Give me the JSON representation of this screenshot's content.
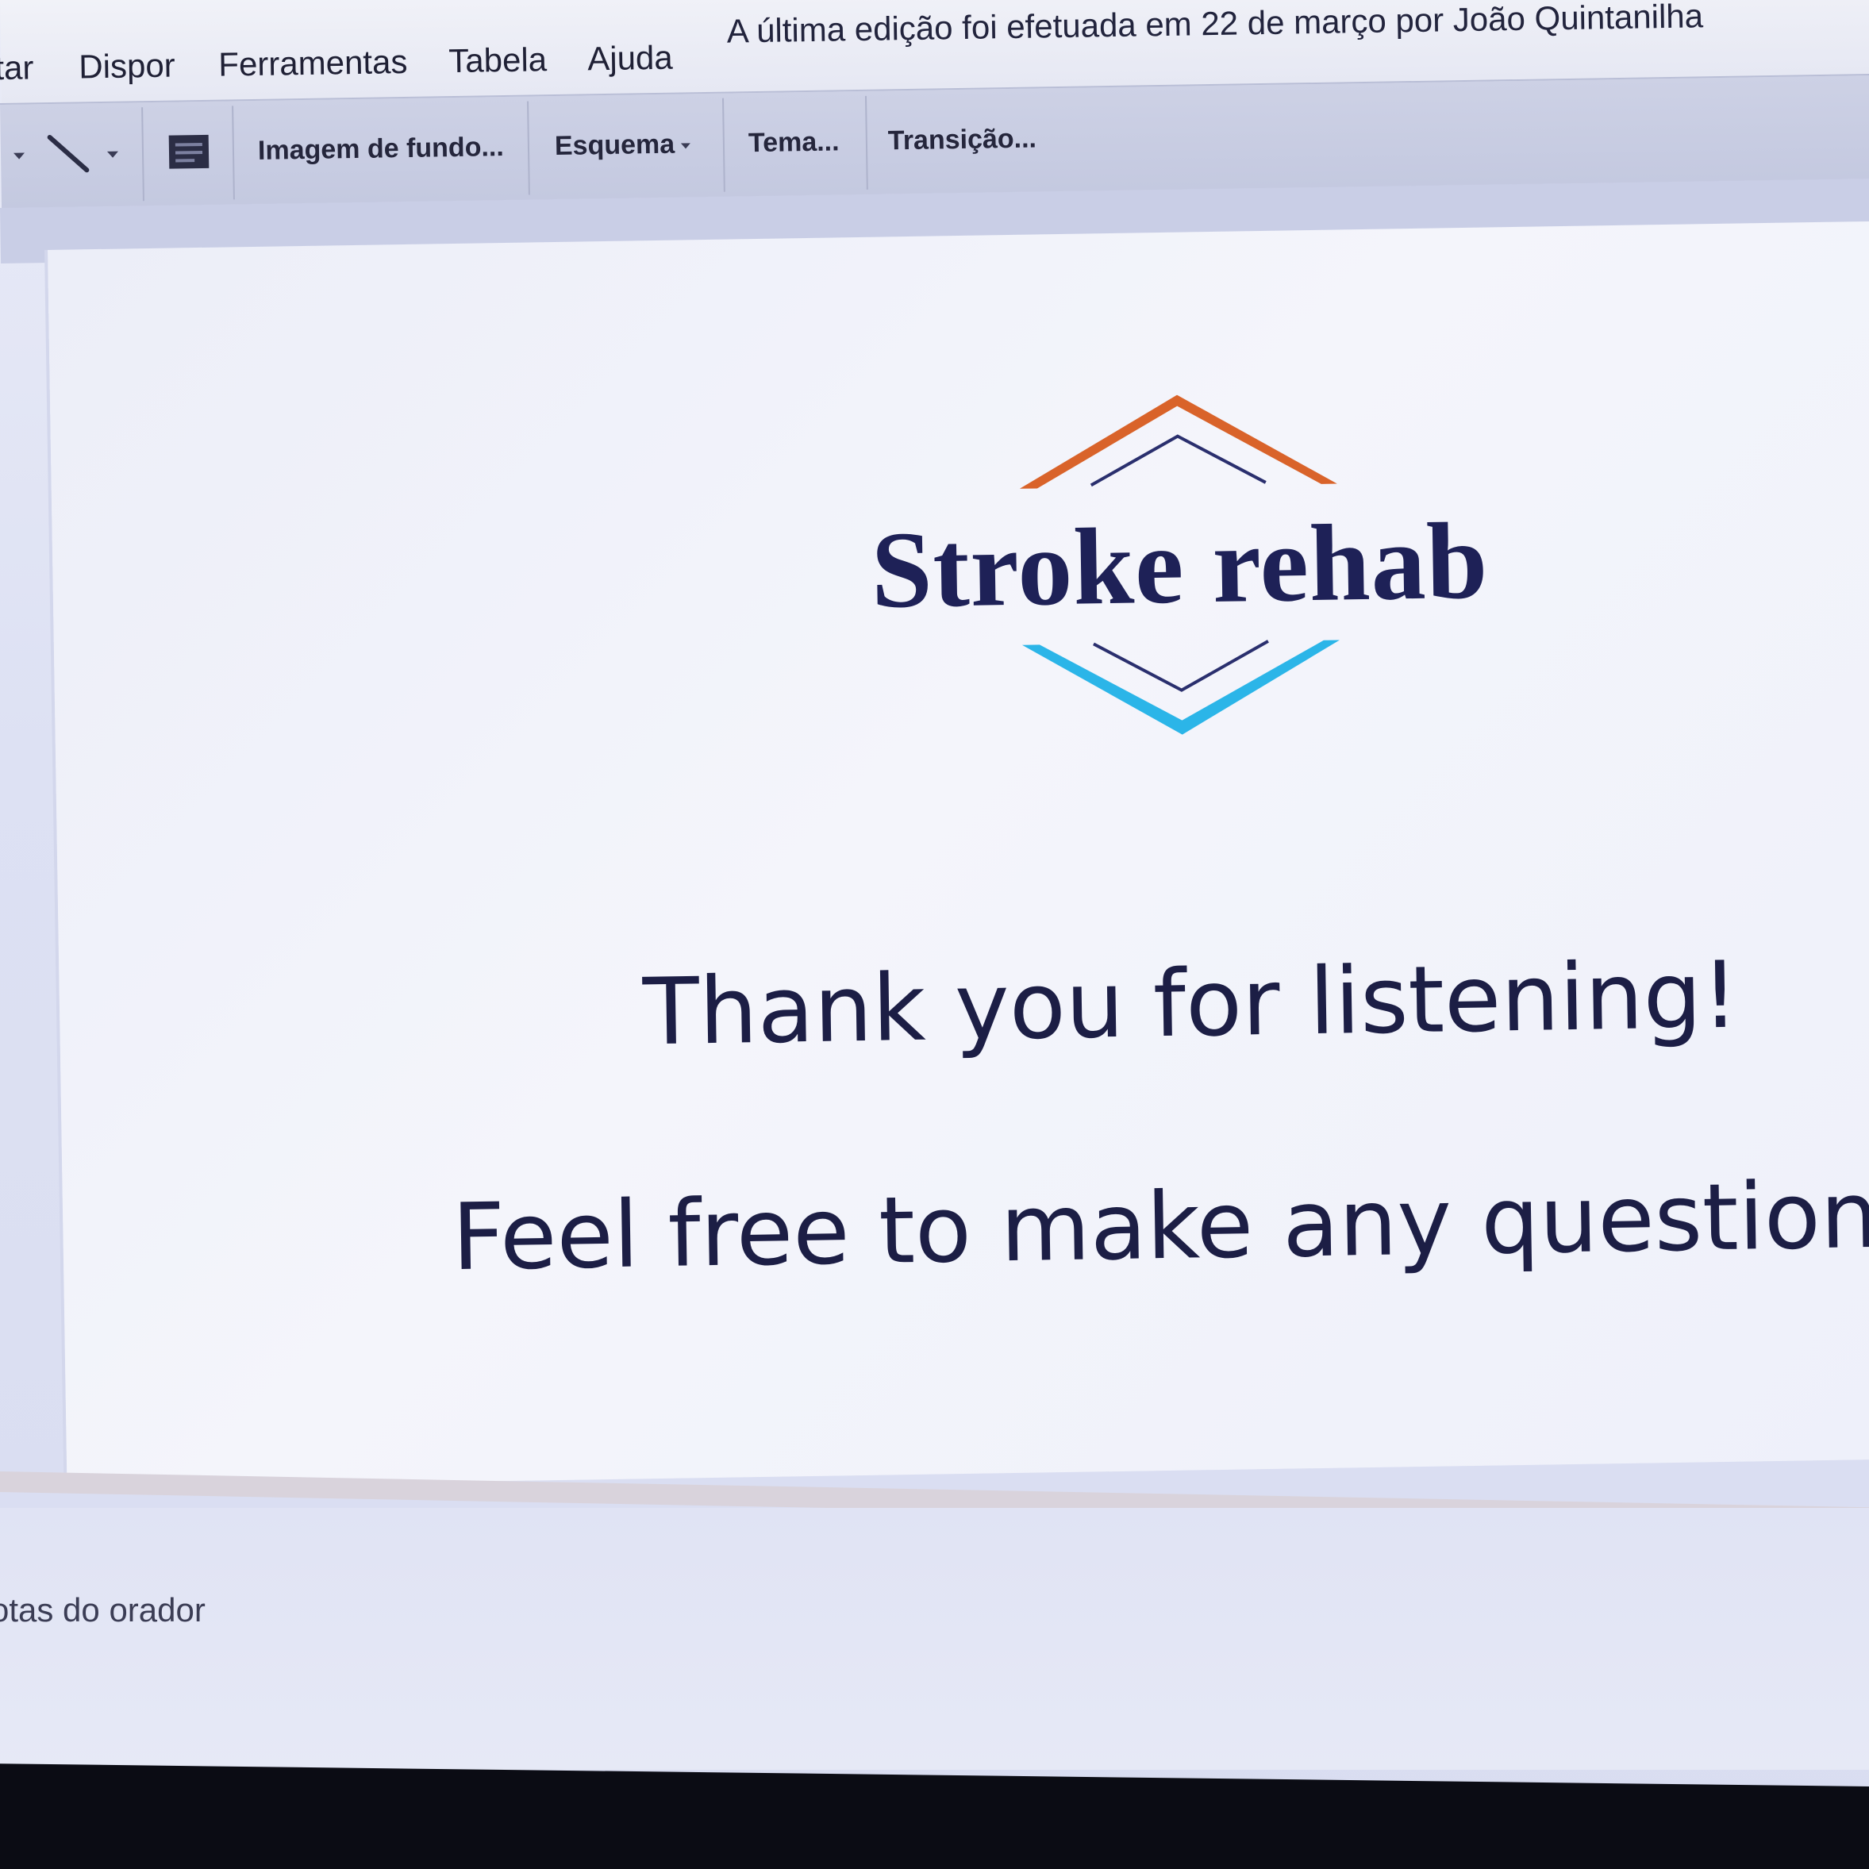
{
  "menu": {
    "items": [
      {
        "label": "tar"
      },
      {
        "label": "Dispor"
      },
      {
        "label": "Ferramentas"
      },
      {
        "label": "Tabela"
      },
      {
        "label": "Ajuda"
      }
    ],
    "last_edit": "A última edição foi efetuada em 22 de março por João Quintanilha"
  },
  "toolbar": {
    "background_image_label": "Imagem de fundo...",
    "layout_label": "Esquema",
    "theme_label": "Tema...",
    "transition_label": "Transição...",
    "icons": [
      "line-dropdown-icon",
      "line-tool-icon",
      "line-style-dropdown-icon",
      "comment-icon"
    ]
  },
  "slide": {
    "logo_text": "Stroke rehab",
    "logo_colors": {
      "top_outer": "#d9632a",
      "top_inner": "#2a2f6e",
      "bottom_outer": "#2bb5e8",
      "bottom_inner": "#2a2f6e",
      "text": "#1e2157"
    },
    "line1": "Thank you for listening!",
    "line2": "Feel free to make any questions."
  },
  "notes": {
    "placeholder": "otas do orador"
  }
}
